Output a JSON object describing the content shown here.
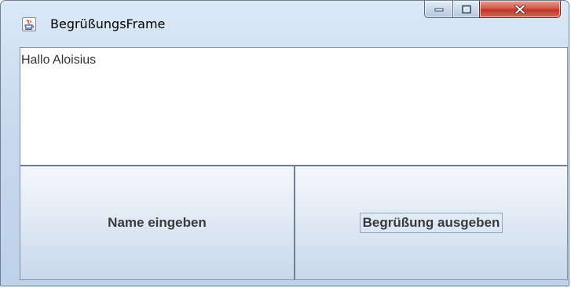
{
  "window": {
    "title": "BegrüßungsFrame",
    "icon": "java-cup-icon"
  },
  "caption_buttons": {
    "minimize": "minimize-icon",
    "maximize": "maximize-icon",
    "close": "close-icon"
  },
  "textarea": {
    "value": "Hallo Aloisius"
  },
  "buttons": {
    "name_label": "Name eingeben",
    "greet_label": "Begrüßung ausgeben"
  },
  "colors": {
    "frame": "#c7d9ee",
    "close_button": "#c2352a",
    "button_gradient_top": "#f4f7fb",
    "button_gradient_bottom": "#c8d8eb"
  }
}
